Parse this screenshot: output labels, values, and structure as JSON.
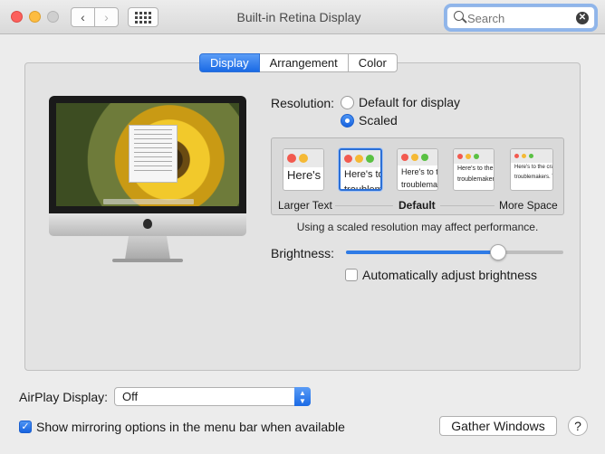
{
  "window": {
    "title": "Built-in Retina Display"
  },
  "toolbar": {
    "back_icon": "chevron-left-icon",
    "forward_icon": "chevron-right-icon",
    "grid_icon": "grid-icon"
  },
  "search": {
    "placeholder": "Search",
    "value": ""
  },
  "tabs": [
    {
      "label": "Display",
      "active": true
    },
    {
      "label": "Arrangement",
      "active": false
    },
    {
      "label": "Color",
      "active": false
    }
  ],
  "resolution": {
    "label": "Resolution:",
    "options": [
      {
        "label": "Default for display",
        "selected": false
      },
      {
        "label": "Scaled",
        "selected": true
      }
    ],
    "scale_labels": {
      "left": "Larger Text",
      "default": "Default",
      "right": "More Space"
    },
    "thumb_text": [
      "Here's",
      "Here's to",
      "Here's to th",
      "Here's to the cr",
      "Here's to the crazy"
    ],
    "thumb_text_line2": [
      "",
      "troublem",
      "troublemak",
      "troublemakers.",
      "troublemakers. The"
    ],
    "selected_index": 1,
    "note": "Using a scaled resolution may affect performance."
  },
  "brightness": {
    "label": "Brightness:",
    "value": 0.7,
    "auto_label": "Automatically adjust brightness",
    "auto_checked": false
  },
  "airplay": {
    "label": "AirPlay Display:",
    "value": "Off"
  },
  "mirroring": {
    "label": "Show mirroring options in the menu bar when available",
    "checked": true
  },
  "buttons": {
    "gather": "Gather Windows",
    "help": "?"
  },
  "colors": {
    "accent": "#1a6ae5",
    "close": "#fc605c",
    "minimize": "#fdbc40",
    "zoom_disabled": "#cfcfcf"
  }
}
